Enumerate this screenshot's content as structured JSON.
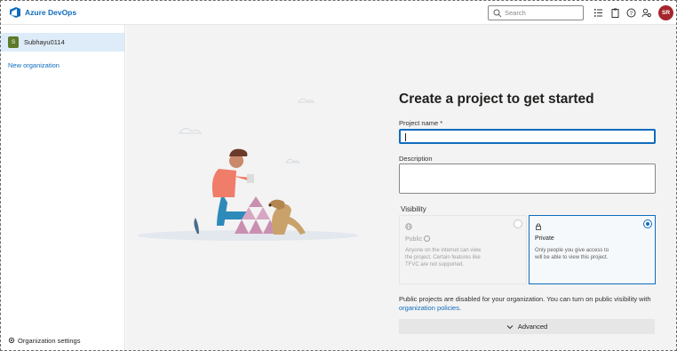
{
  "app": {
    "brand": "Azure DevOps"
  },
  "header": {
    "search_placeholder": "Search",
    "avatar_initials": "SR",
    "icons": [
      "list-checks-icon",
      "clipboard-icon",
      "help-icon",
      "user-settings-icon"
    ]
  },
  "sidebar": {
    "org_initial": "S",
    "org_name": "Subhayu0114",
    "new_org_label": "New organization",
    "settings_label": "Organization settings"
  },
  "form": {
    "title": "Create a project to get started",
    "project_name_label": "Project name *",
    "project_name_value": "",
    "description_label": "Description",
    "description_value": "",
    "visibility_label": "Visibility",
    "public": {
      "title": "Public",
      "description": "Anyone on the internet can view the project. Certain features like TFVC are not supported.",
      "selected": false,
      "disabled": true
    },
    "private": {
      "title": "Private",
      "description": "Only people you give access to will be able to view this project.",
      "selected": true
    },
    "note_text": "Public projects are disabled for your organization. You can turn on public visibility with",
    "note_link": "organization policies",
    "note_end": ".",
    "advanced_label": "Advanced"
  },
  "colors": {
    "accent": "#0f6cbd",
    "avatar_bg": "#a4262c",
    "org_avatar_bg": "#5c7a29",
    "selected_nav_bg": "#deecf9"
  }
}
